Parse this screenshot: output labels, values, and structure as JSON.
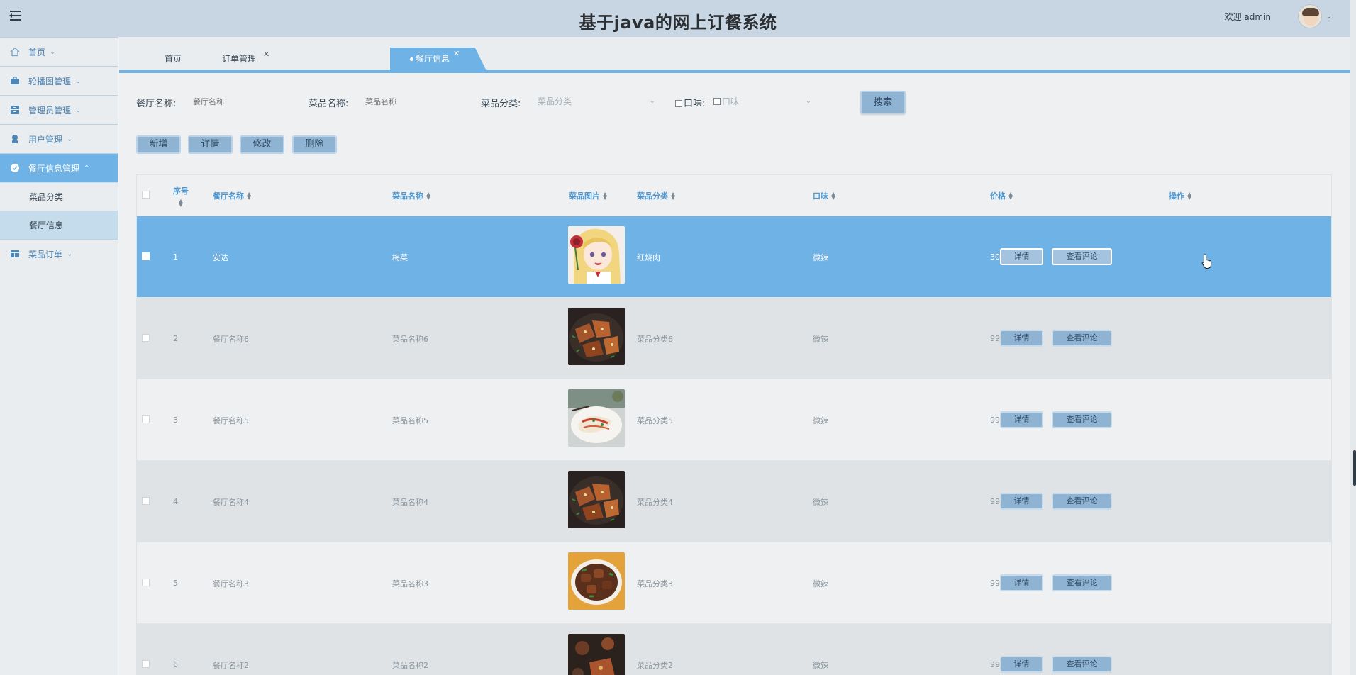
{
  "header": {
    "title": "基于java的网上订餐系统",
    "welcome": "欢迎 admin"
  },
  "sidebar": {
    "items": [
      {
        "label": "首页",
        "icon": "home-icon"
      },
      {
        "label": "轮播图管理",
        "icon": "briefcase-icon"
      },
      {
        "label": "管理员管理",
        "icon": "archive-icon"
      },
      {
        "label": "用户管理",
        "icon": "user-icon"
      },
      {
        "label": "餐厅信息管理",
        "icon": "check-circle-icon"
      },
      {
        "label": "菜品订单",
        "icon": "table-icon"
      }
    ],
    "sub_items": [
      "菜品分类",
      "餐厅信息"
    ]
  },
  "tabs": [
    {
      "label": "首页"
    },
    {
      "label": "订单管理"
    },
    {
      "label": "餐厅信息"
    }
  ],
  "filters": {
    "restaurant_label": "餐厅名称:",
    "restaurant_placeholder": "餐厅名称",
    "dish_label": "菜品名称:",
    "dish_placeholder": "菜品名称",
    "category_label": "菜品分类:",
    "category_placeholder": "菜品分类",
    "taste_label": "口味:",
    "taste_placeholder": "口味",
    "search_button": "搜索"
  },
  "toolbar": {
    "add": "新增",
    "detail": "详情",
    "edit": "修改",
    "delete": "删除"
  },
  "table": {
    "columns": [
      "序号",
      "餐厅名称",
      "菜品名称",
      "菜品图片",
      "菜品分类",
      "口味",
      "价格",
      "操作"
    ],
    "rows": [
      {
        "no": "1",
        "restaurant": "安达",
        "dish": "梅菜",
        "category": "红烧肉",
        "taste": "微辣",
        "price": "30",
        "photo": "anime-girl"
      },
      {
        "no": "2",
        "restaurant": "餐厅名称6",
        "dish": "菜品名称6",
        "category": "菜品分类6",
        "taste": "微辣",
        "price": "99.9",
        "photo": "grilled-meat"
      },
      {
        "no": "3",
        "restaurant": "餐厅名称5",
        "dish": "菜品名称5",
        "category": "菜品分类5",
        "taste": "微辣",
        "price": "99.9",
        "photo": "plated-dish"
      },
      {
        "no": "4",
        "restaurant": "餐厅名称4",
        "dish": "菜品名称4",
        "category": "菜品分类4",
        "taste": "微辣",
        "price": "99.9",
        "photo": "grilled-meat"
      },
      {
        "no": "5",
        "restaurant": "餐厅名称3",
        "dish": "菜品名称3",
        "category": "菜品分类3",
        "taste": "微辣",
        "price": "99.9",
        "photo": "braised-meat"
      },
      {
        "no": "6",
        "restaurant": "餐厅名称2",
        "dish": "菜品名称2",
        "category": "菜品分类2",
        "taste": "微辣",
        "price": "99.9",
        "photo": "dark-dish"
      }
    ],
    "detail_button": "详情",
    "review_button": "查看评论"
  },
  "colors": {
    "accent": "#6fb3e6",
    "header_bg": "#c8d6e3",
    "button_bg": "#8fb3d3",
    "column_header": "#4e97d1"
  }
}
